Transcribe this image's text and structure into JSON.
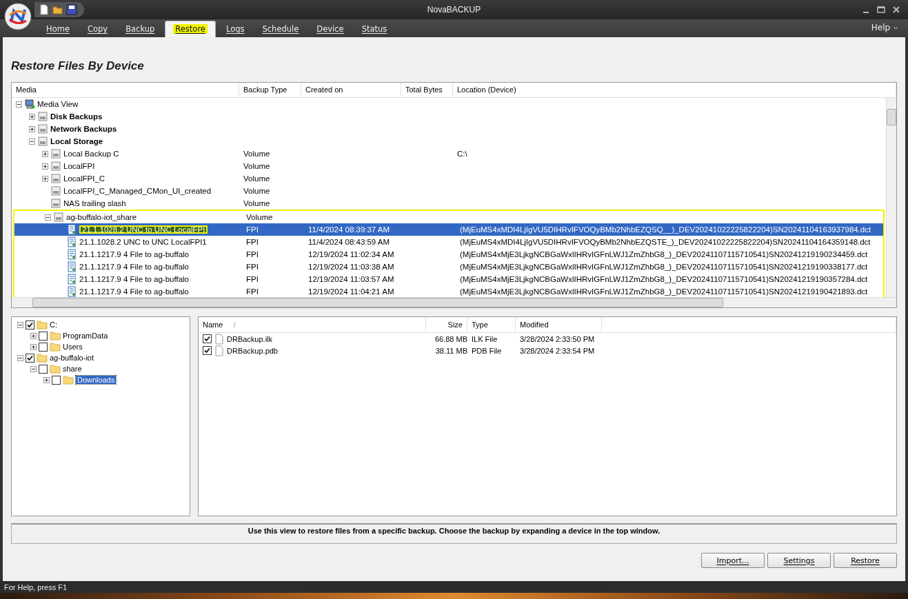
{
  "window": {
    "title": "NovaBACKUP"
  },
  "tabs": [
    {
      "label": "Home",
      "selected": false,
      "highlighted": false
    },
    {
      "label": "Copy",
      "selected": false,
      "highlighted": false
    },
    {
      "label": "Backup",
      "selected": false,
      "highlighted": false
    },
    {
      "label": "Restore",
      "selected": true,
      "highlighted": true
    },
    {
      "label": "Logs",
      "selected": false,
      "highlighted": false
    },
    {
      "label": "Schedule",
      "selected": false,
      "highlighted": false
    },
    {
      "label": "Device",
      "selected": false,
      "highlighted": false
    },
    {
      "label": "Status",
      "selected": false,
      "highlighted": false
    }
  ],
  "help_menu": "Help",
  "page_title": "Restore Files By Device",
  "media_list": {
    "columns": [
      "Media",
      "Backup Type",
      "Created on",
      "Total Bytes",
      "Location (Device)"
    ],
    "tree": [
      {
        "kind": "root",
        "label": "Media View",
        "expanded": true,
        "children": [
          {
            "kind": "group",
            "label": "Disk Backups",
            "expanded": false
          },
          {
            "kind": "group",
            "label": "Network Backups",
            "expanded": false
          },
          {
            "kind": "group",
            "label": "Local Storage",
            "expanded": true,
            "children": [
              {
                "kind": "device",
                "label": "Local Backup C",
                "expanded": false,
                "backup_type": "Volume",
                "location": "C:\\"
              },
              {
                "kind": "device",
                "label": "LocalFPI",
                "expanded": false,
                "backup_type": "Volume"
              },
              {
                "kind": "device",
                "label": "LocalFPI_C",
                "expanded": false,
                "backup_type": "Volume"
              },
              {
                "kind": "device",
                "label": "LocalFPI_C_Managed_CMon_UI_created",
                "backup_type": "Volume"
              },
              {
                "kind": "device",
                "label": "NAS trailing slash",
                "backup_type": "Volume"
              },
              {
                "kind": "device",
                "label": "ag-buffalo-iot_share",
                "expanded": true,
                "framed": true,
                "backup_type": "Volume",
                "children": [
                  {
                    "kind": "backup",
                    "label": "21.1.1028.2 UNC to UNC LocalFPI",
                    "selected": true,
                    "highlighted": true,
                    "backup_type": "FPI",
                    "created_on": "11/4/2024 08:39:37 AM",
                    "location": "(MjEuMS4xMDI4LjIgVU5DIHRvIFVOQyBMb2NhbEZQSQ__)_DEV20241022225822204)SN20241104163937984.dct"
                  },
                  {
                    "kind": "backup",
                    "label": "21.1.1028.2 UNC to UNC LocalFPI1",
                    "selected": false,
                    "highlighted": false,
                    "backup_type": "FPI",
                    "created_on": "11/4/2024 08:43:59 AM",
                    "location": "(MjEuMS4xMDI4LjIgVU5DIHRvIFVOQyBMb2NhbEZQSTE_)_DEV20241022225822204)SN20241104164359148.dct"
                  },
                  {
                    "kind": "backup",
                    "label": "21.1.1217.9 4 File to ag-buffalo",
                    "selected": false,
                    "highlighted": false,
                    "backup_type": "FPI",
                    "created_on": "12/19/2024 11:02:34 AM",
                    "location": "(MjEuMS4xMjE3LjkgNCBGaWxlIHRvIGFnLWJ1ZmZhbG8_)_DEV20241107115710541)SN20241219190234459.dct"
                  },
                  {
                    "kind": "backup",
                    "label": "21.1.1217.9 4 File to ag-buffalo",
                    "selected": false,
                    "highlighted": false,
                    "backup_type": "FPI",
                    "created_on": "12/19/2024 11:03:38 AM",
                    "location": "(MjEuMS4xMjE3LjkgNCBGaWxlIHRvIGFnLWJ1ZmZhbG8_)_DEV20241107115710541)SN20241219190338177.dct"
                  },
                  {
                    "kind": "backup",
                    "label": "21.1.1217.9 4 File to ag-buffalo",
                    "selected": false,
                    "highlighted": false,
                    "backup_type": "FPI",
                    "created_on": "12/19/2024 11:03:57 AM",
                    "location": "(MjEuMS4xMjE3LjkgNCBGaWxlIHRvIGFnLWJ1ZmZhbG8_)_DEV20241107115710541)SN20241219190357284.dct"
                  },
                  {
                    "kind": "backup",
                    "label": "21.1.1217.9 4 File to ag-buffalo",
                    "selected": false,
                    "highlighted": false,
                    "backup_type": "FPI",
                    "created_on": "12/19/2024 11:04:21 AM",
                    "location": "(MjEuMS4xMjE3LjkgNCBGaWxlIHRvIGFnLWJ1ZmZhbG8_)_DEV20241107115710541)SN20241219190421893.dct"
                  }
                ]
              }
            ]
          }
        ]
      }
    ]
  },
  "folder_tree": [
    {
      "label": "C:",
      "checked": true,
      "expanded": true,
      "selected": false,
      "children": [
        {
          "label": "ProgramData",
          "checked": false,
          "expanded": false,
          "selected": false
        },
        {
          "label": "Users",
          "checked": false,
          "expanded": false,
          "selected": false
        }
      ]
    },
    {
      "label": "ag-buffalo-iot",
      "checked": true,
      "expanded": true,
      "selected": false,
      "children": [
        {
          "label": "share",
          "checked": false,
          "expanded": true,
          "selected": false,
          "children": [
            {
              "label": "Downloads",
              "checked": false,
              "expanded": false,
              "selected": true
            }
          ]
        }
      ]
    }
  ],
  "file_list": {
    "columns": [
      "Name",
      "Size",
      "Type",
      "Modified"
    ],
    "sort_mark": "/",
    "rows": [
      {
        "name": "DRBackup.ilk",
        "size": "66.88 MB",
        "type": "ILK File",
        "modified": "3/28/2024 2:33:50 PM",
        "checked": true
      },
      {
        "name": "DRBackup.pdb",
        "size": "38.11 MB",
        "type": "PDB File",
        "modified": "3/28/2024 2:33:54 PM",
        "checked": true
      }
    ]
  },
  "hint": "Use this view to restore files from a specific backup. Choose the backup by expanding a device in the top window.",
  "buttons": [
    "Import...",
    "Settings",
    "Restore"
  ],
  "status_bar": "For Help, press F1"
}
